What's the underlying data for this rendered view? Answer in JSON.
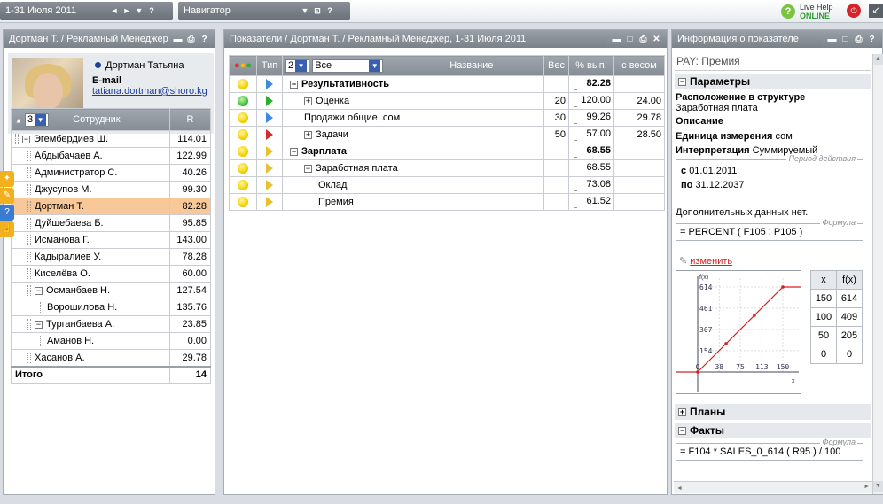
{
  "topbar": {
    "period": "1-31 Июля 2011",
    "period_icons": [
      "◄",
      "►",
      "▼",
      "?"
    ],
    "navigator": "Навигатор",
    "navigator_icons": [
      "▼",
      "⊡",
      "?"
    ],
    "live_help": "Live Help",
    "online": "ONLINE"
  },
  "employees_panel": {
    "title": "Дортман Т. / Рекламный Менеджер",
    "profile_name": "Дортман Татьяна",
    "email_label": "E-mail",
    "email": "tatiana.dortman@shoro.kg",
    "level_select": "3",
    "col_employee": "Сотрудник",
    "col_r": "R",
    "rows": [
      {
        "name": "Эгембердиев Ш.",
        "value": "114.01",
        "expander": "minus",
        "indent": 0
      },
      {
        "name": "Абдыбачаев А.",
        "value": "122.99",
        "expander": "",
        "indent": 1
      },
      {
        "name": "Администратор С.",
        "value": "40.26",
        "expander": "",
        "indent": 1
      },
      {
        "name": "Джусупов М.",
        "value": "99.30",
        "expander": "",
        "indent": 1
      },
      {
        "name": "Дортман Т.",
        "value": "82.28",
        "expander": "",
        "indent": 1
      },
      {
        "name": "Дуйшебаева Б.",
        "value": "95.85",
        "expander": "",
        "indent": 1
      },
      {
        "name": "Исманова Г.",
        "value": "143.00",
        "expander": "",
        "indent": 1
      },
      {
        "name": "Кадыралиев У.",
        "value": "78.28",
        "expander": "",
        "indent": 1
      },
      {
        "name": "Киселёва О.",
        "value": "60.00",
        "expander": "",
        "indent": 1
      },
      {
        "name": "Османбаев Н.",
        "value": "127.54",
        "expander": "minus",
        "indent": 1
      },
      {
        "name": "Ворошилова Н.",
        "value": "135.76",
        "expander": "",
        "indent": 2
      },
      {
        "name": "Турганбаева А.",
        "value": "23.85",
        "expander": "minus",
        "indent": 1
      },
      {
        "name": "Аманов Н.",
        "value": "0.00",
        "expander": "",
        "indent": 2
      },
      {
        "name": "Хасанов А.",
        "value": "29.78",
        "expander": "",
        "indent": 1
      }
    ],
    "total_label": "Итого",
    "total_value": "14"
  },
  "indicators_panel": {
    "title": "Показатели / Дортман Т. / Рекламный Менеджер, 1-31 Июля 2011",
    "col_type": "Тип",
    "level_select": "2",
    "filter_select": "Все",
    "col_name": "Название",
    "col_weight": "Вес",
    "col_pct": "% вып.",
    "col_weighted": "с весом",
    "rows": [
      {
        "lamp": "yellow",
        "type": "blue",
        "expander": "minus",
        "indent": 0,
        "name": "Результативность",
        "bold": true,
        "weight": "",
        "pct": "82.28",
        "weighted": ""
      },
      {
        "lamp": "green",
        "type": "green",
        "expander": "plus",
        "indent": 1,
        "name": "Оценка",
        "bold": false,
        "weight": "20",
        "pct": "120.00",
        "weighted": "24.00"
      },
      {
        "lamp": "yellow",
        "type": "blue",
        "expander": "",
        "indent": 1,
        "name": "Продажи общие, сом",
        "bold": false,
        "weight": "30",
        "pct": "99.26",
        "weighted": "29.78"
      },
      {
        "lamp": "yellow",
        "type": "red",
        "expander": "plus",
        "indent": 1,
        "name": "Задачи",
        "bold": false,
        "weight": "50",
        "pct": "57.00",
        "weighted": "28.50"
      },
      {
        "lamp": "yellow",
        "type": "yellow",
        "expander": "minus",
        "indent": 0,
        "name": "Зарплата",
        "bold": true,
        "weight": "",
        "pct": "68.55",
        "weighted": ""
      },
      {
        "lamp": "yellow",
        "type": "yellow",
        "expander": "minus",
        "indent": 1,
        "name": "Заработная плата",
        "bold": false,
        "weight": "",
        "pct": "68.55",
        "weighted": ""
      },
      {
        "lamp": "yellow",
        "type": "yellow",
        "expander": "",
        "indent": 2,
        "name": "Оклад",
        "bold": false,
        "weight": "",
        "pct": "73.08",
        "weighted": ""
      },
      {
        "lamp": "yellow",
        "type": "yellow",
        "expander": "",
        "indent": 2,
        "name": "Премия",
        "bold": false,
        "weight": "",
        "pct": "61.52",
        "weighted": ""
      }
    ]
  },
  "info_panel": {
    "title": "Информация о показателе",
    "code": "PAY: Премия",
    "params_header": "Параметры",
    "structure_label": "Расположение в структуре",
    "structure_value": "Заработная плата",
    "description_label": "Описание",
    "unit_label": "Единица измерения",
    "unit_value": "сом",
    "interp_label": "Интерпретация",
    "interp_value": "Суммируемый",
    "period_legend": "Период действия",
    "from_label": "с",
    "from_value": "01.01.2011",
    "to_label": "по",
    "to_value": "31.12.2037",
    "extra_text": "Дополнительных данных нет.",
    "formula_legend": "Формула",
    "formula": "= PERCENT ( F105 ; P105 )",
    "edit_link": "изменить",
    "plans_header": "Планы",
    "facts_header": "Факты",
    "facts_formula_legend": "Формула",
    "facts_formula": "= F104 * SALES_0_614 ( R95 ) / 100"
  },
  "chart_data": {
    "type": "line",
    "x": [
      0,
      150,
      200
    ],
    "y": [
      0,
      614,
      614
    ],
    "ylabel": "f(x)",
    "xlabel": "x",
    "xticks": [
      "0",
      "38",
      "75",
      "113",
      "150"
    ],
    "yticks": [
      "154",
      "307",
      "461",
      "614"
    ],
    "color": "#d62020",
    "table": {
      "headers": [
        "x",
        "f(x)"
      ],
      "rows": [
        [
          "150",
          "614"
        ],
        [
          "100",
          "409"
        ],
        [
          "50",
          "205"
        ],
        [
          "0",
          "0"
        ]
      ]
    }
  }
}
